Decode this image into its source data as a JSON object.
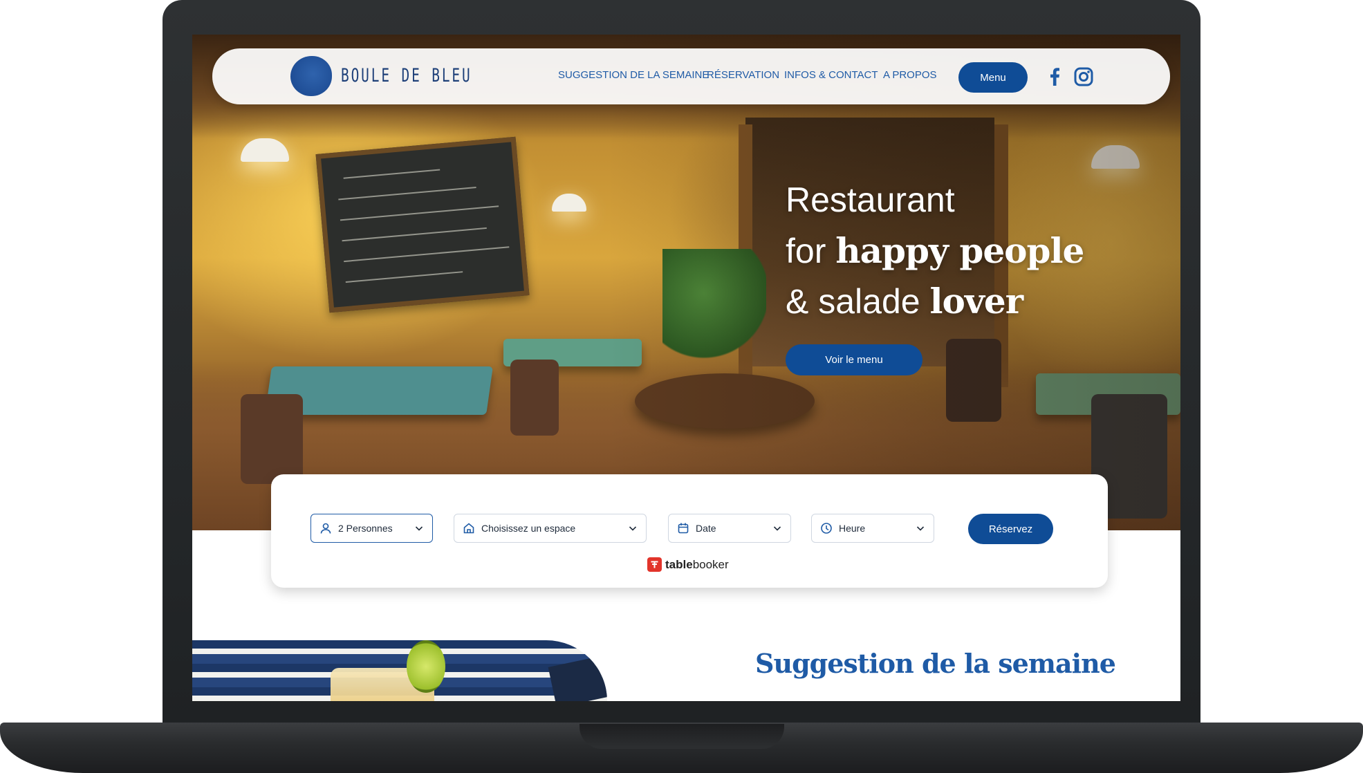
{
  "brand": {
    "name": "BOULE DE BLEU",
    "primary_color": "#0f4c96",
    "link_color": "#1f5ba6"
  },
  "nav": {
    "items": [
      {
        "label": "SUGGESTION DE LA SEMAINE"
      },
      {
        "label": "RÉSERVATION"
      },
      {
        "label": "INFOS & CONTACT"
      },
      {
        "label": "A PROPOS"
      }
    ],
    "menu_button": "Menu",
    "social": [
      {
        "icon": "facebook-icon"
      },
      {
        "icon": "instagram-icon"
      }
    ]
  },
  "hero": {
    "line1": "Restaurant",
    "line2_light": "for ",
    "line2_bold": "happy people",
    "line3_light": "& salade ",
    "line3_bold": "lover",
    "cta": "Voir le menu"
  },
  "booking": {
    "fields": [
      {
        "icon": "user-icon",
        "value": "2 Personnes"
      },
      {
        "icon": "home-icon",
        "value": "Choisissez un espace"
      },
      {
        "icon": "calendar-icon",
        "value": "Date"
      },
      {
        "icon": "clock-icon",
        "value": "Heure"
      }
    ],
    "submit": "Réservez",
    "provider_bold": "table",
    "provider_rest": "booker"
  },
  "section": {
    "title": "Suggestion de la semaine"
  }
}
